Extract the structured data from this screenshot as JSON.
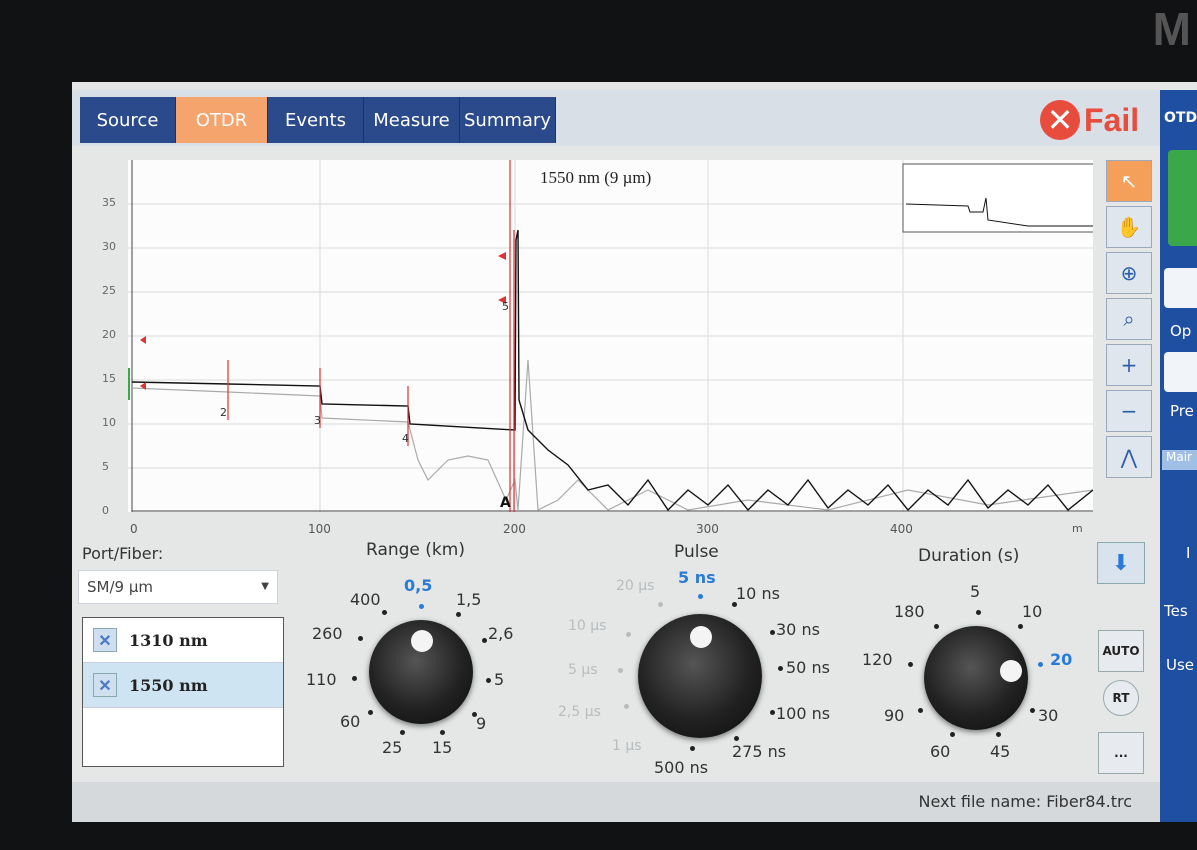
{
  "bezel_letter": "M",
  "tabs": [
    {
      "label": "Source",
      "active": false
    },
    {
      "label": "OTDR",
      "active": true
    },
    {
      "label": "Events",
      "active": false
    },
    {
      "label": "Measure",
      "active": false
    },
    {
      "label": "Summary",
      "active": false
    }
  ],
  "status": {
    "label": "Fail",
    "color": "#e84c3d"
  },
  "side_panel": {
    "title": "OTD",
    "open_label": "Op",
    "prev_label": "Pre",
    "main_tab": "Mair",
    "test_label": "Tes",
    "user_label": "Use",
    "i_label": "I"
  },
  "graph": {
    "wavelength_label": "1550 nm (9 µm)",
    "y_ticks": [
      "35",
      "30",
      "25",
      "20",
      "15",
      "10",
      "5",
      "0"
    ],
    "x_ticks": [
      "0",
      "100",
      "200",
      "300",
      "400"
    ],
    "x_unit": "m",
    "marker_label": "A",
    "event_labels": [
      "2",
      "3",
      "4",
      "5"
    ]
  },
  "port_fiber": {
    "label": "Port/Fiber:",
    "selected": "SM/9 µm",
    "wavelengths": [
      {
        "label": "1310 nm",
        "checked": true,
        "selected": false
      },
      {
        "label": "1550 nm",
        "checked": true,
        "selected": true
      }
    ]
  },
  "range": {
    "label": "Range (km)",
    "options": [
      "0,5",
      "1,5",
      "2,6",
      "5",
      "9",
      "15",
      "25",
      "60",
      "110",
      "260",
      "400"
    ],
    "selected": "0,5"
  },
  "pulse": {
    "label": "Pulse",
    "options": [
      "5 ns",
      "10 ns",
      "30 ns",
      "50 ns",
      "100 ns",
      "275 ns",
      "500 ns",
      "1 µs",
      "2,5 µs",
      "5 µs",
      "10 µs",
      "20 µs"
    ],
    "selected": "5 ns"
  },
  "duration": {
    "label": "Duration (s)",
    "options": [
      "5",
      "10",
      "20",
      "30",
      "45",
      "60",
      "90",
      "120",
      "180"
    ],
    "selected": "20"
  },
  "right_buttons": {
    "auto": "AUTO",
    "rt": "RT",
    "more": "..."
  },
  "footer": {
    "next_file": "Next file name: Fiber84.trc"
  },
  "colors": {
    "tab": "#2b4a8c",
    "tab_active": "#f4a46c",
    "accent": "#2a7bd6",
    "fail": "#e84c3d"
  }
}
